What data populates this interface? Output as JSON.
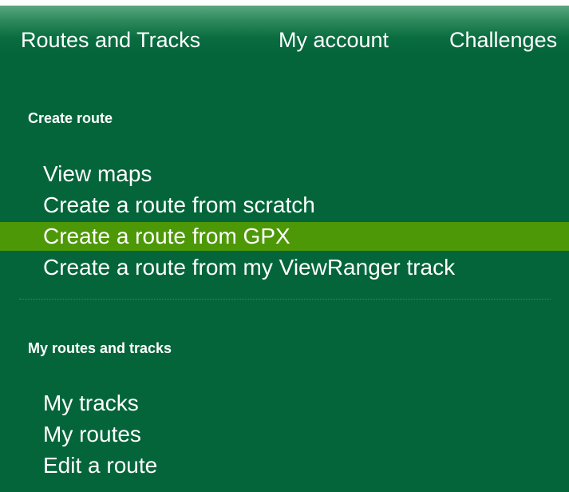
{
  "topnav": {
    "items": [
      {
        "label": "Routes and Tracks"
      },
      {
        "label": "My account"
      },
      {
        "label": "Challenges"
      }
    ]
  },
  "sections": [
    {
      "heading": "Create route",
      "items": [
        {
          "label": "View maps"
        },
        {
          "label": "Create a route from scratch"
        },
        {
          "label": "Create a route from GPX",
          "active": true
        },
        {
          "label": "Create a route from my ViewRanger track"
        }
      ]
    },
    {
      "heading": "My routes and tracks",
      "items": [
        {
          "label": "My tracks"
        },
        {
          "label": "My routes"
        },
        {
          "label": "Edit a route"
        }
      ]
    }
  ],
  "colors": {
    "background": "#04653a",
    "active_item": "#4d9807",
    "text": "#ffffff"
  }
}
